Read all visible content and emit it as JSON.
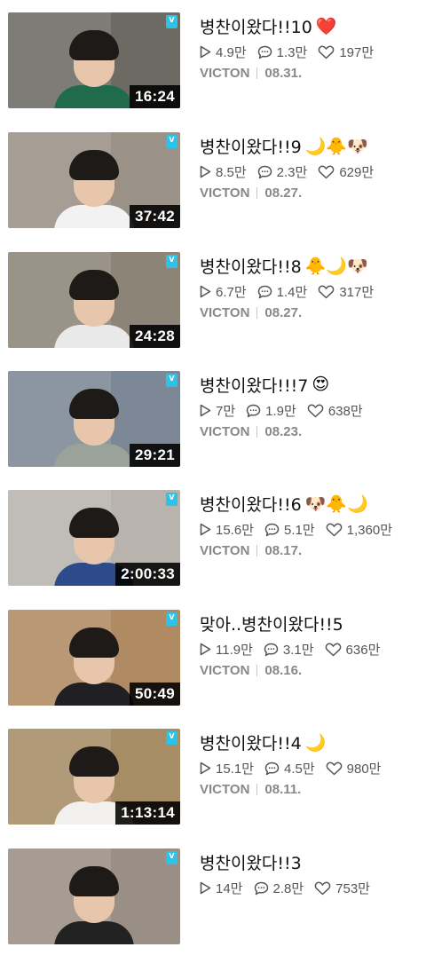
{
  "videos": [
    {
      "title": "병찬이왔다!!10",
      "emojis": [
        "❤️"
      ],
      "views": "4.9만",
      "comments": "1.3만",
      "likes": "197만",
      "channel": "VICTON",
      "date": "08.31.",
      "duration": "16:24",
      "bg": "#6d6a63",
      "shirt": "#1f6b4c"
    },
    {
      "title": "병찬이왔다!!9",
      "emojis": [
        "🌙",
        "🐥",
        "🐶"
      ],
      "views": "8.5만",
      "comments": "2.3만",
      "likes": "629만",
      "channel": "VICTON",
      "date": "08.27.",
      "duration": "37:42",
      "bg": "#9a9187",
      "shirt": "#f2f2f2"
    },
    {
      "title": "병찬이왔다!!8",
      "emojis": [
        "🐥",
        "🌙",
        "🐶"
      ],
      "views": "6.7만",
      "comments": "1.4만",
      "likes": "317만",
      "channel": "VICTON",
      "date": "08.27.",
      "duration": "24:28",
      "bg": "#8d8478",
      "shirt": "#e9e9e9"
    },
    {
      "title": "병찬이왔다!!!7",
      "emojis": [
        "😍"
      ],
      "views": "7만",
      "comments": "1.9만",
      "likes": "638만",
      "channel": "VICTON",
      "date": "08.23.",
      "duration": "29:21",
      "bg": "#7d8896",
      "shirt": "#9aa39a"
    },
    {
      "title": "병찬이왔다!!6",
      "emojis": [
        "🐶",
        "🐥",
        "🌙"
      ],
      "views": "15.6만",
      "comments": "5.1만",
      "likes": "1,360만",
      "channel": "VICTON",
      "date": "08.17.",
      "duration": "2:00:33",
      "bg": "#b8b3ad",
      "shirt": "#2d4a8a"
    },
    {
      "title": "맞아..병찬이왔다!!5",
      "emojis": [],
      "views": "11.9만",
      "comments": "3.1만",
      "likes": "636만",
      "channel": "VICTON",
      "date": "08.16.",
      "duration": "50:49",
      "bg": "#b08a62",
      "shirt": "#1f1f24"
    },
    {
      "title": "병찬이왔다!!4",
      "emojis": [
        "🌙"
      ],
      "views": "15.1만",
      "comments": "4.5만",
      "likes": "980만",
      "channel": "VICTON",
      "date": "08.11.",
      "duration": "1:13:14",
      "bg": "#a78d66",
      "shirt": "#f1f0ec"
    },
    {
      "title": "병찬이왔다!!3",
      "emojis": [],
      "views": "14만",
      "comments": "2.8만",
      "likes": "753만",
      "channel": "",
      "date": "",
      "duration": "",
      "bg": "#9a8f85",
      "shirt": "#222"
    }
  ]
}
